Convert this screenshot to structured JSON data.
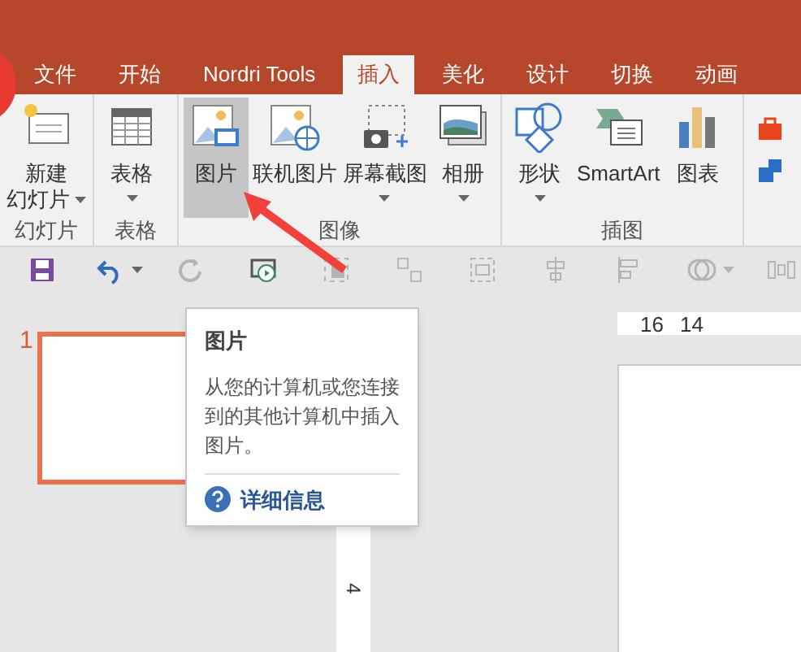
{
  "tabs": [
    {
      "label": "文件",
      "selected": false
    },
    {
      "label": "开始",
      "selected": false
    },
    {
      "label": "Nordri Tools",
      "selected": false
    },
    {
      "label": "插入",
      "selected": true
    },
    {
      "label": "美化",
      "selected": false
    },
    {
      "label": "设计",
      "selected": false
    },
    {
      "label": "切换",
      "selected": false
    },
    {
      "label": "动画",
      "selected": false
    }
  ],
  "ribbon_groups": [
    {
      "label": "幻灯片",
      "buttons": [
        {
          "kind": "new-slide",
          "lines": [
            "新建",
            "幻灯片"
          ],
          "dropdown": true,
          "selected": false
        }
      ]
    },
    {
      "label": "表格",
      "buttons": [
        {
          "kind": "table",
          "lines": [
            "表格"
          ],
          "dropdown": true,
          "selected": false
        }
      ]
    },
    {
      "label": "图像",
      "buttons": [
        {
          "kind": "picture",
          "lines": [
            "图片"
          ],
          "dropdown": false,
          "selected": true
        },
        {
          "kind": "online-picture",
          "lines": [
            "联机图片"
          ],
          "dropdown": false,
          "selected": false
        },
        {
          "kind": "screenshot",
          "lines": [
            "屏幕截图"
          ],
          "dropdown": true,
          "selected": false
        },
        {
          "kind": "album",
          "lines": [
            "相册"
          ],
          "dropdown": true,
          "selected": false
        }
      ]
    },
    {
      "label": "插图",
      "buttons": [
        {
          "kind": "shapes",
          "lines": [
            "形状"
          ],
          "dropdown": true,
          "selected": false
        },
        {
          "kind": "smartart",
          "lines": [
            "SmartArt"
          ],
          "dropdown": false,
          "selected": false
        },
        {
          "kind": "chart",
          "lines": [
            "图表"
          ],
          "dropdown": false,
          "selected": false
        }
      ]
    }
  ],
  "quick_access": [
    {
      "kind": "save",
      "disabled": false,
      "dropdown": false
    },
    {
      "kind": "undo",
      "disabled": false,
      "dropdown": true
    },
    {
      "kind": "redo",
      "disabled": true,
      "dropdown": false
    },
    {
      "kind": "slideshow",
      "disabled": false,
      "dropdown": false
    },
    {
      "kind": "group",
      "disabled": true,
      "dropdown": false
    },
    {
      "kind": "ungroup",
      "disabled": true,
      "dropdown": false
    },
    {
      "kind": "select",
      "disabled": true,
      "dropdown": false
    },
    {
      "kind": "align-center",
      "disabled": true,
      "dropdown": false
    },
    {
      "kind": "align-left",
      "disabled": true,
      "dropdown": false
    },
    {
      "kind": "merge",
      "disabled": true,
      "dropdown": true
    },
    {
      "kind": "distribute",
      "disabled": true,
      "dropdown": false
    }
  ],
  "slides": [
    {
      "number": "1",
      "selected": true
    }
  ],
  "horizontal_ruler": [
    "16",
    "14"
  ],
  "vertical_ruler": [
    "4"
  ],
  "tooltip": {
    "title": "图片",
    "description": "从您的计算机或您连接到的其他计算机中插入图片。",
    "link": "详细信息"
  }
}
